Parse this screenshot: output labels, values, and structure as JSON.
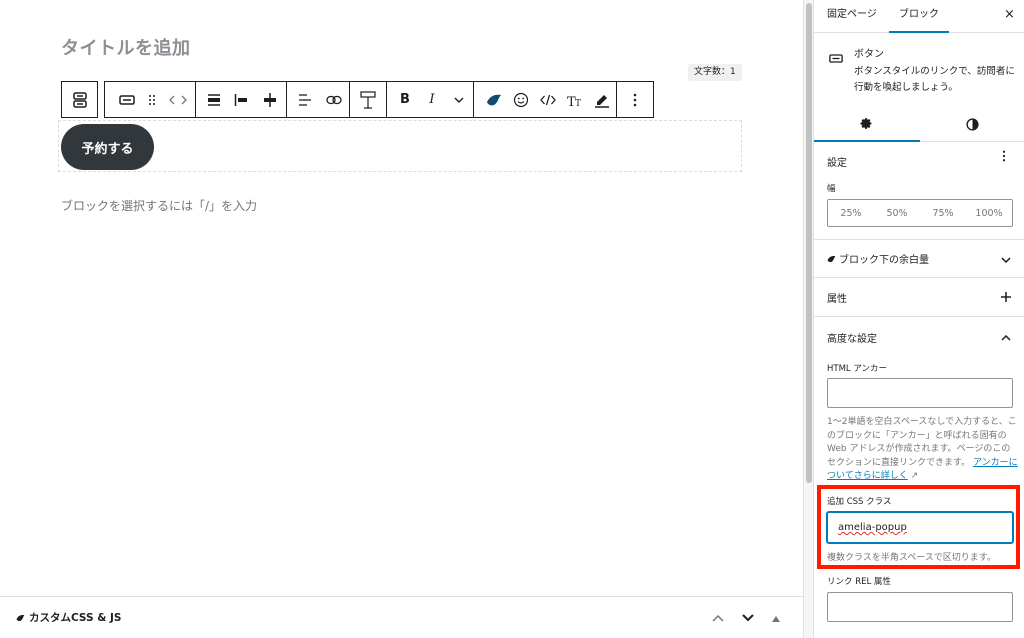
{
  "editor": {
    "title_placeholder": "タイトルを追加",
    "char_count": "文字数：1",
    "button_text": "予約する",
    "block_hint": "ブロックを選択するには「/」を入力"
  },
  "toolbar": {
    "icons": [
      "block-transform-icon",
      "button-block-icon",
      "drag-handle-icon",
      "code-arrows-icon",
      "align-full-icon",
      "align-left-icon",
      "align-center-icon",
      "justify-icon",
      "link-icon",
      "vertical-align-icon",
      "italic-icon",
      "chevron-down-icon",
      "swell-icon",
      "emoji-icon",
      "html-code-icon",
      "text-size-icon",
      "highlighter-icon",
      "more-options-icon"
    ],
    "bold": "B",
    "italic": "I"
  },
  "meta_bar": {
    "title": "カスタムCSS & JS"
  },
  "sidebar": {
    "tab_page": "固定ページ",
    "tab_block": "ブロック",
    "close": "×",
    "block_name": "ボタン",
    "block_description": "ボタンスタイルのリンクで、訪問者に行動を喚起しましょう。",
    "settings_title": "設定",
    "width_label": "幅",
    "width_options": [
      "25%",
      "50%",
      "75%",
      "100%"
    ],
    "panels": {
      "bottom_margin": "ブロック下の余白量",
      "attributes": "属性",
      "advanced": "高度な設定"
    },
    "anchor_label": "HTML アンカー",
    "anchor_help": "1〜2単語を空白スペースなしで入力すると、このブロックに「アンカー」と呼ばれる固有の Web アドレスが作成されます。ページのこのセクションに直接リンクできます。",
    "anchor_link": "アンカーについてさらに詳しく",
    "css_label": "追加 CSS クラス",
    "css_value": "amelia-popup",
    "css_help": "複数クラスを半角スペースで区切ります。",
    "rel_label": "リンク REL 属性"
  },
  "colors": {
    "accent": "#007cba",
    "button_bg": "#32373c",
    "highlight": "#ff1a00"
  }
}
